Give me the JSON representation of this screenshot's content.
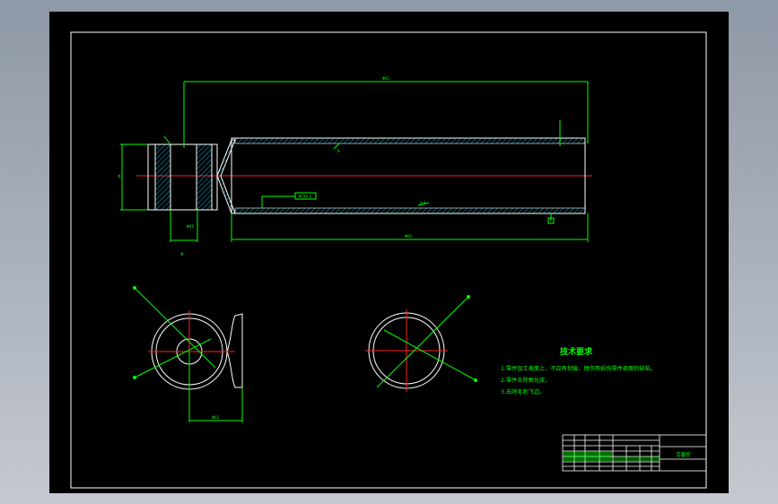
{
  "dimensions": {
    "overall_length": "Φ61",
    "tube_length": "Φ61",
    "flange_gap": "Φ40",
    "end_diameter": "Φ",
    "flange_width": "Φ",
    "view_offset": "Φ61"
  },
  "annotations": {
    "bore_tag": "Φ7X0.5",
    "wall_left": "8",
    "wall_bottom": "0.6"
  },
  "tech_requirements": {
    "title": "技术要求",
    "items": [
      "1.零件加工表面上，不应有划痕、擦伤等损伤零件表面的缺陷。",
      "2.零件去除氧化皮。",
      "3.去除毛刺飞边。"
    ]
  },
  "title_block": {
    "part_name": "活塞杆"
  },
  "colors": {
    "outline": "#ffffff",
    "dimension": "#00ff00",
    "centerline": "#ff2020",
    "hatch": "#00b0d8"
  }
}
